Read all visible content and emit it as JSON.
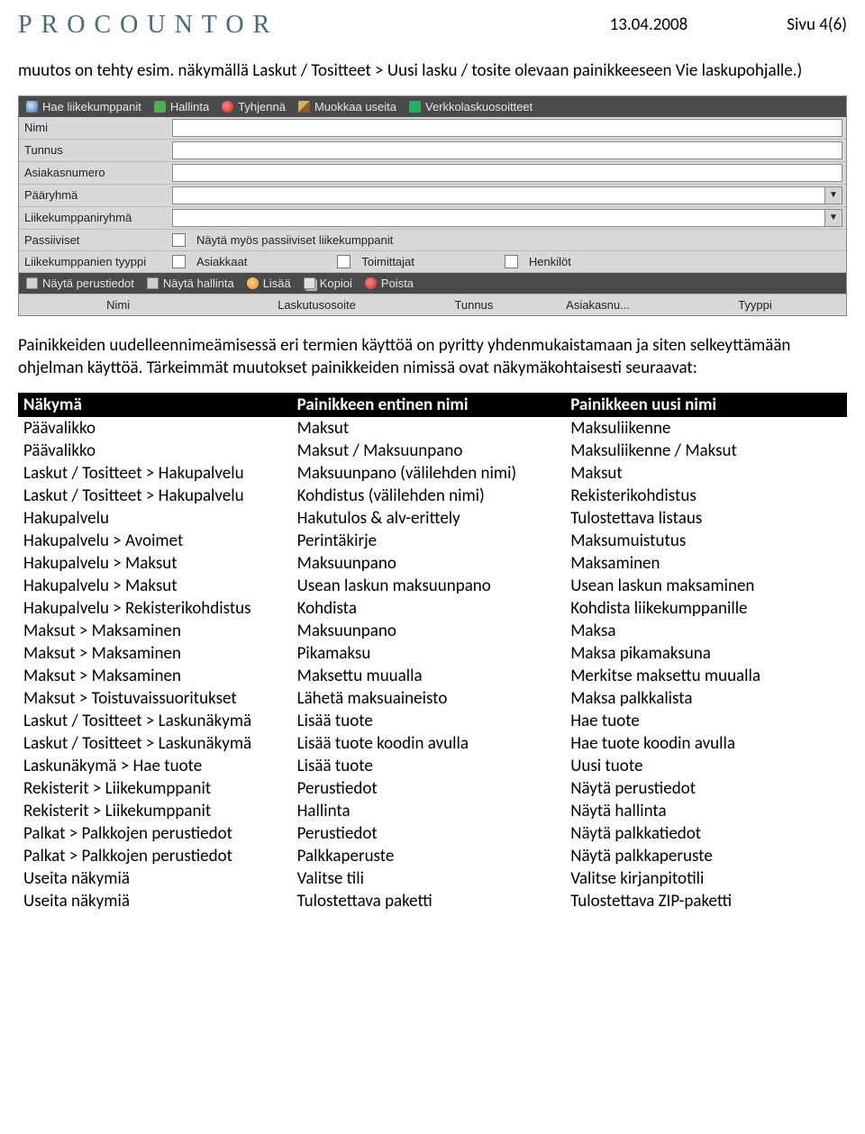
{
  "header": {
    "logo": "PROCOUNTOR",
    "date": "13.04.2008",
    "page": "Sivu 4(6)"
  },
  "intro1": "muutos on tehty esim. näkymällä Laskut / Tositteet > Uusi lasku / tosite olevaan painikkeeseen Vie laskupohjalle.)",
  "intro2": "Painikkeiden uudelleennimeämisessä eri termien käyttöä on pyritty yhdenmukaistamaan ja siten selkeyttämään ohjelman käyttöä. Tärkeimmät muutokset painikkeiden nimissä ovat näkymäkohtaisesti seuraavat:",
  "app": {
    "toolbar_top": {
      "partners": "Hae liikekumppanit",
      "admin": "Hallinta",
      "clear": "Tyhjennä",
      "edit": "Muokkaa useita",
      "einvoice": "Verkkolaskuosoitteet"
    },
    "form": {
      "name": "Nimi",
      "code": "Tunnus",
      "custno": "Asiakasnumero",
      "maingroup": "Pääryhmä",
      "partnergroup": "Liikekumppaniryhmä",
      "passive": "Passiiviset",
      "passive_chk": "Näytä myös passiiviset liikekumppanit",
      "type": "Liikekumppanien tyyppi",
      "type_cust": "Asiakkaat",
      "type_supp": "Toimittajat",
      "type_pers": "Henkilöt"
    },
    "toolbar_mid": {
      "showbasic": "Näytä perustiedot",
      "showadmin": "Näytä hallinta",
      "add": "Lisää",
      "copy": "Kopioi",
      "delete": "Poista"
    },
    "grid": {
      "c1": "Nimi",
      "c2": "Laskutusosoite",
      "c3": "Tunnus",
      "c4": "Asiakasnu...",
      "c5": "Tyyppi"
    }
  },
  "chart_data": {
    "type": "table",
    "columns": [
      "Näkymä",
      "Painikkeen entinen nimi",
      "Painikkeen uusi nimi"
    ],
    "rows": [
      [
        "Päävalikko",
        "Maksut",
        "Maksuliikenne"
      ],
      [
        "Päävalikko",
        "Maksut / Maksuunpano",
        "Maksuliikenne / Maksut"
      ],
      [
        "Laskut / Tositteet > Hakupalvelu",
        "Maksuunpano (välilehden nimi)",
        "Maksut"
      ],
      [
        "Laskut / Tositteet > Hakupalvelu",
        "Kohdistus (välilehden nimi)",
        "Rekisterikohdistus"
      ],
      [
        "Hakupalvelu",
        "Hakutulos & alv-erittely",
        "Tulostettava listaus"
      ],
      [
        "Hakupalvelu > Avoimet",
        "Perintäkirje",
        "Maksumuistutus"
      ],
      [
        "Hakupalvelu > Maksut",
        "Maksuunpano",
        "Maksaminen"
      ],
      [
        "Hakupalvelu > Maksut",
        "Usean laskun maksuunpano",
        "Usean laskun maksaminen"
      ],
      [
        "Hakupalvelu > Rekisterikohdistus",
        "Kohdista",
        "Kohdista liikekumppanille"
      ],
      [
        "Maksut > Maksaminen",
        "Maksuunpano",
        "Maksa"
      ],
      [
        "Maksut > Maksaminen",
        "Pikamaksu",
        "Maksa pikamaksuna"
      ],
      [
        "Maksut > Maksaminen",
        "Maksettu muualla",
        "Merkitse maksettu muualla"
      ],
      [
        "Maksut > Toistuvaissuoritukset",
        "Lähetä maksuaineisto",
        "Maksa palkkalista"
      ],
      [
        "Laskut / Tositteet > Laskunäkymä",
        "Lisää tuote",
        "Hae tuote"
      ],
      [
        "Laskut / Tositteet > Laskunäkymä",
        "Lisää tuote koodin avulla",
        "Hae tuote koodin avulla"
      ],
      [
        "Laskunäkymä > Hae tuote",
        "Lisää tuote",
        "Uusi tuote"
      ],
      [
        "Rekisterit > Liikekumppanit",
        "Perustiedot",
        "Näytä perustiedot"
      ],
      [
        "Rekisterit > Liikekumppanit",
        "Hallinta",
        "Näytä hallinta"
      ],
      [
        "Palkat > Palkkojen perustiedot",
        "Perustiedot",
        "Näytä palkkatiedot"
      ],
      [
        "Palkat > Palkkojen perustiedot",
        "Palkkaperuste",
        "Näytä palkkaperuste"
      ],
      [
        "Useita näkymiä",
        "Valitse tili",
        "Valitse kirjanpitotili"
      ],
      [
        "Useita näkymiä",
        "Tulostettava paketti",
        "Tulostettava ZIP-paketti"
      ]
    ]
  }
}
